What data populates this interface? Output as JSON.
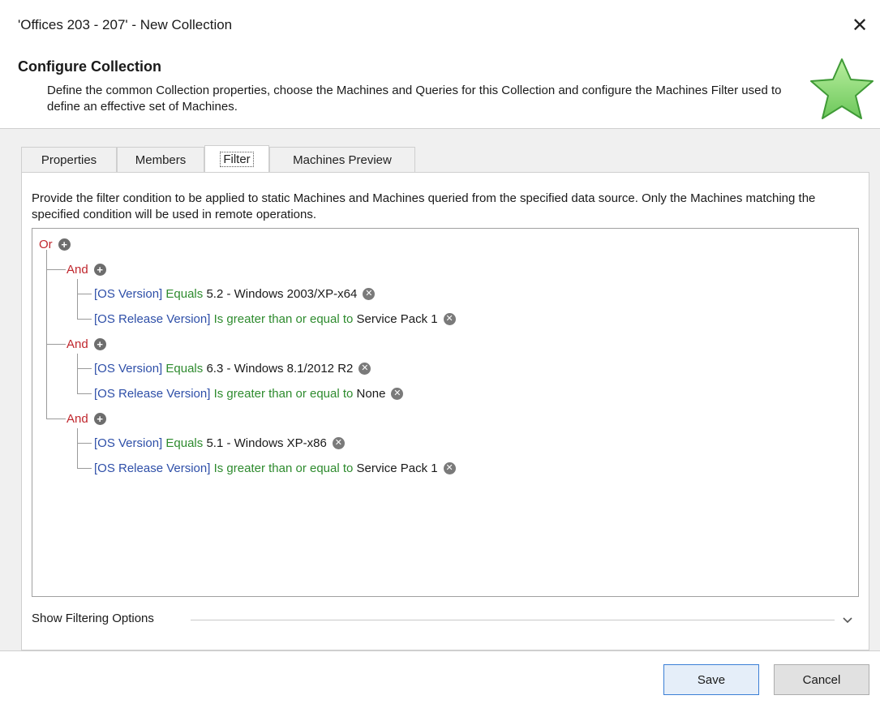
{
  "window": {
    "title": "'Offices 203 - 207' - New Collection",
    "close_glyph": "✕"
  },
  "header": {
    "title": "Configure Collection",
    "description": "Define the common Collection properties, choose the Machines and Queries for this Collection and configure the Machines Filter used to define an effective set of Machines.",
    "icon": "star-icon",
    "icon_color": "#8fd97a"
  },
  "tabs": [
    {
      "label": "Properties",
      "active": false
    },
    {
      "label": "Members",
      "active": false
    },
    {
      "label": "Filter",
      "active": true
    },
    {
      "label": "Machines Preview",
      "active": false
    }
  ],
  "filter": {
    "description": "Provide the filter condition to be applied to static Machines and Machines queried from the specified data source. Only the Machines matching the specified condition will be used in remote operations.",
    "root_operator": "Or",
    "groups": [
      {
        "operator": "And",
        "conditions": [
          {
            "field": "[OS Version]",
            "operator": "Equals",
            "value": "5.2 - Windows 2003/XP-x64"
          },
          {
            "field": "[OS Release Version]",
            "operator": "Is greater than or equal to",
            "value": "Service Pack 1"
          }
        ]
      },
      {
        "operator": "And",
        "conditions": [
          {
            "field": "[OS Version]",
            "operator": "Equals",
            "value": "6.3 - Windows 8.1/2012 R2"
          },
          {
            "field": "[OS Release Version]",
            "operator": "Is greater than or equal to",
            "value": "None"
          }
        ]
      },
      {
        "operator": "And",
        "conditions": [
          {
            "field": "[OS Version]",
            "operator": "Equals",
            "value": "5.1 - Windows XP-x86"
          },
          {
            "field": "[OS Release Version]",
            "operator": "Is greater than or equal to",
            "value": "Service Pack 1"
          }
        ]
      }
    ],
    "colors": {
      "operator": "#c0262d",
      "field": "#2e4fa8",
      "condition": "#2e8b2e"
    },
    "show_options_label": "Show Filtering Options"
  },
  "footer": {
    "save_label": "Save",
    "cancel_label": "Cancel"
  }
}
